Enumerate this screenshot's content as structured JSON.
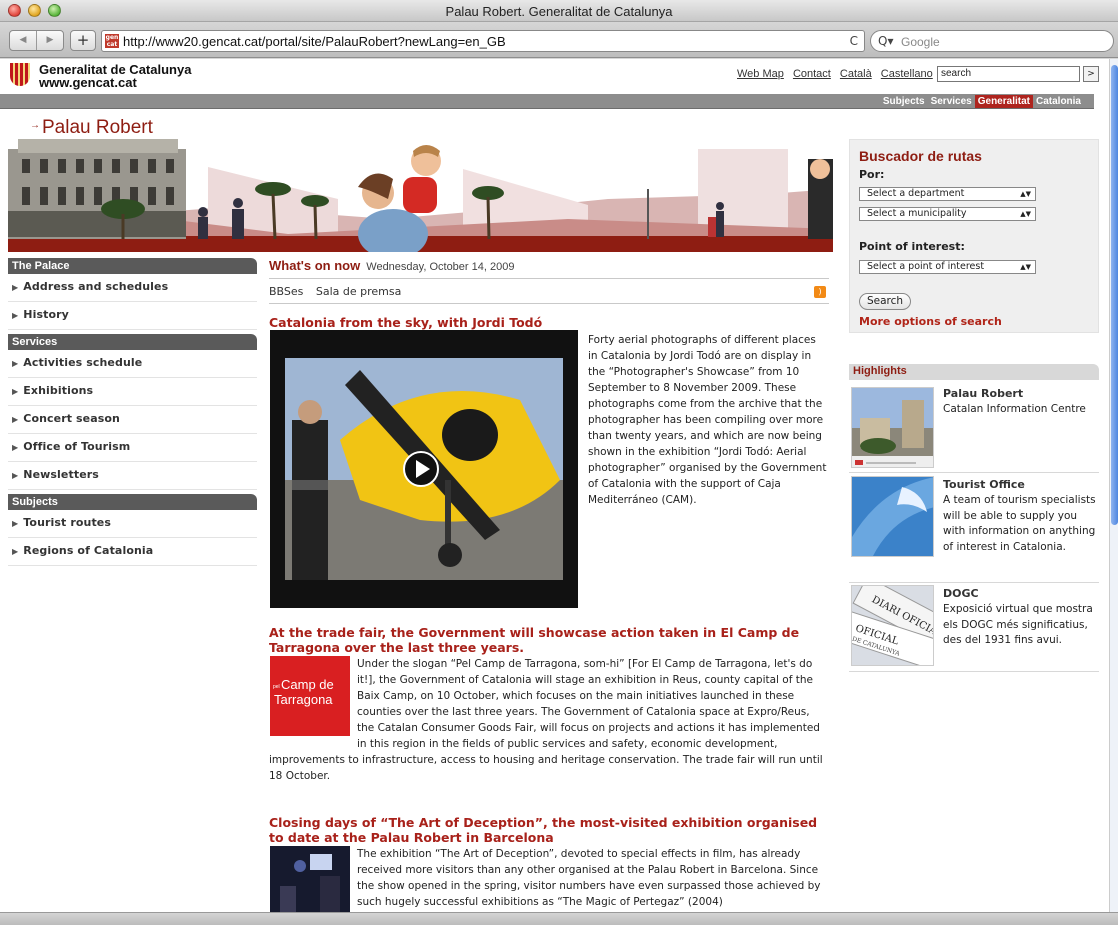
{
  "browser": {
    "window_title": "Palau Robert. Generalitat de Catalunya",
    "url": "http://www20.gencat.cat/portal/site/PalauRobert?newLang=en_GB",
    "search_placeholder": "Google",
    "search_prefix": "Q▾",
    "add_label": "+",
    "back_label": "◀",
    "forward_label": "▶",
    "reload_label": "C",
    "favicon_text": "gen cat"
  },
  "header": {
    "org_name_line1": "Generalitat de Catalunya",
    "org_name_line2": "www.gencat.cat",
    "links": [
      "Web Map",
      "Contact",
      "Català",
      "Castellano"
    ],
    "search_value": "search",
    "search_go": ">"
  },
  "graynav": {
    "items": [
      "Subjects",
      "Services",
      "Generalitat",
      "Catalonia"
    ],
    "active": "Generalitat"
  },
  "site": {
    "arrow": "→",
    "title": "Palau Robert"
  },
  "sidebar": {
    "sections": [
      {
        "header": "The Palace",
        "items": [
          "Address and schedules",
          "History"
        ]
      },
      {
        "header": "Services",
        "items": [
          "Activities schedule",
          "Exhibitions",
          "Concert season",
          "Office of Tourism",
          "Newsletters"
        ]
      },
      {
        "header": "Subjects",
        "items": [
          "Tourist routes",
          "Regions of Catalonia"
        ]
      }
    ]
  },
  "main": {
    "whats_on_label": "What's on now",
    "date": "Wednesday, October 14, 2009",
    "subnav": [
      "BBSes",
      "Sala de premsa"
    ],
    "rss_label": "RSS",
    "articles": [
      {
        "title": "Catalonia from the sky, with Jordi Todó",
        "text": "Forty aerial photographs of different places in Catalonia by Jordi Todó are on display in the “Photographer's Showcase” from 10 September to 8 November 2009. These photographs come from the archive that the photographer has been compiling over more than twenty years, and which are now being shown in the exhibition “Jordi Todó: Aerial photographer” organised by the Government of Catalonia with the support of Caja Mediterráneo (CAM)."
      },
      {
        "title": "At the trade fair, the Government will showcase action taken in El Camp de Tarragona over the last three years.",
        "image_caption_small": "pel",
        "image_caption_line1": "Camp de",
        "image_caption_line2": "Tarragona",
        "text": "Under the slogan “Pel Camp de Tarragona, som-hi” [For El Camp de Tarragona, let's do it!], the Government of Catalonia will stage an exhibition in Reus, county capital of the Baix Camp, on 10 October, which focuses on the main initiatives launched in these counties over the last three years. The Government of Catalonia space at Expro/Reus, the Catalan Consumer Goods Fair, will focus on projects and actions it has implemented in this region in the fields of public services and safety, economic development, improvements to infrastructure, access to housing and heritage conservation. The trade fair will run until 18 October."
      },
      {
        "title": "Closing days of “The Art of Deception”, the most-visited exhibition organised to date at the Palau Robert in Barcelona",
        "text": "The exhibition “The Art of Deception”, devoted to special effects in film, has already received more visitors than any other organised at the Palau Robert in Barcelona. Since the show opened in the spring, visitor numbers have even surpassed those achieved by such hugely successful exhibitions as “The Magic of Pertegaz” (2004)"
      }
    ]
  },
  "route_finder": {
    "title": "Buscador de rutas",
    "by_label": "Por:",
    "select_department": "Select a department",
    "select_municipality": "Select a municipality",
    "poi_label": "Point of interest:",
    "select_poi": "Select a point of interest",
    "search_button": "Search",
    "more_options": "More options of search"
  },
  "highlights": {
    "header": "Highlights",
    "items": [
      {
        "title": "Palau Robert",
        "desc": "Catalan Information Centre"
      },
      {
        "title": "Tourist Office",
        "desc": "A team of tourism specialists will be able to supply you with information on anything of interest in Catalonia."
      },
      {
        "title": "DOGC",
        "desc": "Exposició virtual que mostra els DOGC més significatius, des del 1931 fins avui."
      }
    ],
    "dogc_thumb_text": [
      "DIARI OFICIAL",
      "OFICIAL",
      "DE CATALUNYA"
    ]
  },
  "colors": {
    "brand_red": "#8e1d12",
    "link_red": "#a8211a",
    "gray_bar": "#8d8d8d"
  }
}
